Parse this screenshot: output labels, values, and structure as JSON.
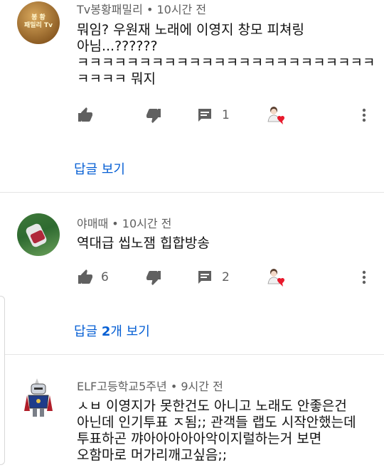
{
  "comments": [
    {
      "author": "Tv봉황패밀리",
      "time": "10시간 전",
      "text": "뭐임? 우원재 노래에 이영지 창모 피쳐링\n아님...??????\nㅋㅋㅋㅋㅋㅋㅋㅋㅋㅋㅋㅋㅋㅋㅋㅋㅋㅋㅋㅋㅋㅋㅋㅋ\nㅋㅋㅋㅋ 뭐지",
      "likes": "",
      "replies_count": "1",
      "reply_link": "답글 보기",
      "avatar_text_line1": "봉 황",
      "avatar_text_line2": "패밀리 Tv"
    },
    {
      "author": "야매때",
      "time": "10시간 전",
      "text": "역대급 씹노잼 힙합방송",
      "likes": "6",
      "replies_count": "2",
      "reply_prefix": "답글 ",
      "reply_count_bold": "2",
      "reply_suffix": "개 보기"
    },
    {
      "author": "ELF고등학교5주년",
      "time": "9시간 전",
      "text": "ㅅㅂ 이영지가 못한건도 아니고 노래도 안좋은건\n아닌데 인기투표 ㅈ됨;; 관객들 랩도 시작안했는데\n투표하곤 꺄아아아아아악이지럴하는거 보면\n오함마로 머가리깨고싶음;;"
    }
  ],
  "separator": "•",
  "colors": {
    "link": "#065fd4",
    "meta": "#606060",
    "heart": "#e8192c"
  },
  "icons": [
    "thumb-up-icon",
    "thumb-down-icon",
    "reply-icon",
    "creator-heart-icon",
    "more-icon"
  ]
}
